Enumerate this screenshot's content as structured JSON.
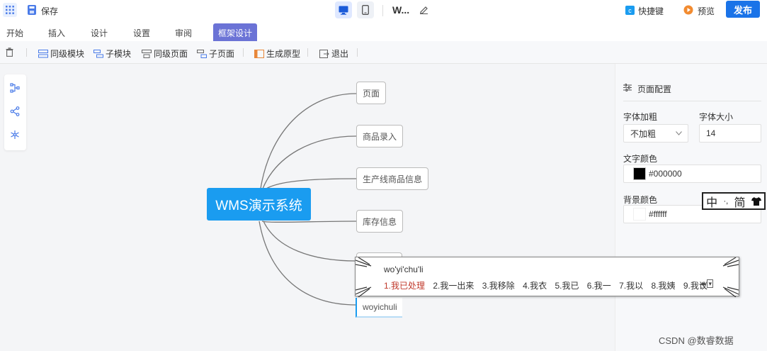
{
  "topbar": {
    "save_label": "保存",
    "doc_title": "W...",
    "shortcut_label": "快捷键",
    "preview_label": "预览",
    "publish_label": "发布"
  },
  "tabs": [
    {
      "label": "开始"
    },
    {
      "label": "插入"
    },
    {
      "label": "设计"
    },
    {
      "label": "设置"
    },
    {
      "label": "审阅"
    },
    {
      "label": "框架设计",
      "active": true
    }
  ],
  "toolbar": {
    "items": [
      {
        "label": "同级模块",
        "icon": "sibling-module-icon"
      },
      {
        "label": "子模块",
        "icon": "child-module-icon"
      },
      {
        "label": "同级页面",
        "icon": "sibling-page-icon"
      },
      {
        "label": "子页面",
        "icon": "child-page-icon"
      },
      {
        "label": "生成原型",
        "icon": "generate-prototype-icon"
      },
      {
        "label": "退出",
        "icon": "exit-icon"
      }
    ]
  },
  "mindmap": {
    "root": "WMS演示系统",
    "children": [
      "页面",
      "商品录入",
      "生产线商品信息",
      "库存信息"
    ],
    "editing_text": "woyichuli"
  },
  "panel": {
    "title": "页面配置",
    "font_weight_label": "字体加粗",
    "font_weight_value": "不加粗",
    "font_size_label": "字体大小",
    "font_size_value": "14",
    "text_color_label": "文字颜色",
    "text_color_value": "#000000",
    "bg_color_label": "背景颜色",
    "bg_color_value": "#ffffff"
  },
  "ime": {
    "bar": [
      "中",
      "·,",
      "简"
    ],
    "pinyin": "wo'yi'chu'li",
    "candidates": [
      "1.我已处理",
      "2.我一出来",
      "3.我移除",
      "4.我衣",
      "5.我已",
      "6.我一",
      "7.我以",
      "8.我姨",
      "9.我议"
    ]
  },
  "colors": {
    "primary": "#1a73e8",
    "root_node": "#1a9cf0",
    "active_tab": "#6b73d6"
  },
  "watermark": "CSDN @数睿数据"
}
